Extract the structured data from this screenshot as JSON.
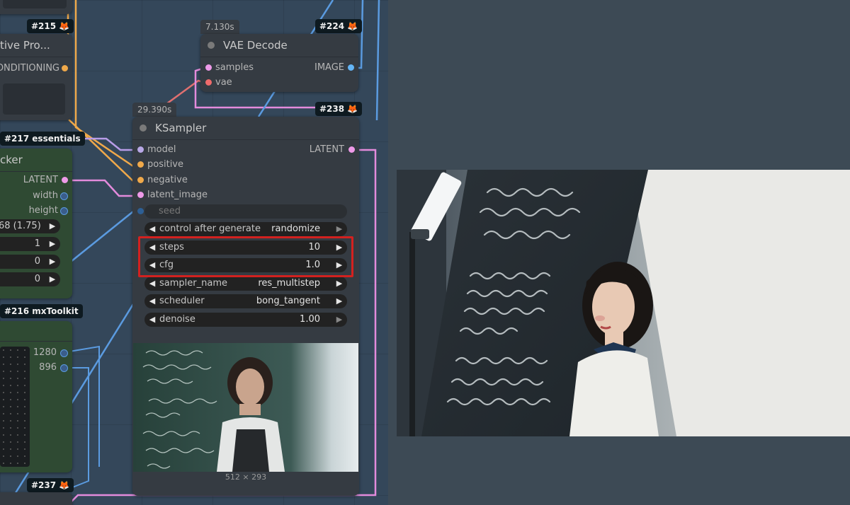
{
  "colors": {
    "canvas_bg": "#34475a",
    "node_bg": "#353b42",
    "green_node_bg": "#2f4a33",
    "highlight": "#d3211f",
    "wire_pink": "#e38bdc",
    "wire_orange": "#f0a94a",
    "wire_blue": "#5b9be0",
    "wire_lavender": "#b89de8",
    "wire_red": "#e07070",
    "latent_dot": "#ee9ae8",
    "model_dot": "#b8a8e6",
    "cond_dot": "#f0a94a",
    "vae_dot": "#ef6b6b",
    "image_dot": "#64b5f6",
    "int_dot": "#5b9be0"
  },
  "left_nodes": {
    "prompt_title": "tive Pro...",
    "prompt_output": "ONDITIONING",
    "badge_215": "#215",
    "badge_217": "#217 essentials",
    "latent_title": "cker",
    "latent_outputs": [
      "LATENT",
      "width",
      "height"
    ],
    "latent_values": [
      "68 (1.75)",
      "1",
      "0",
      "0"
    ],
    "badge_216": "#216 mxToolkit",
    "toolkit_values": [
      "1280",
      "896"
    ],
    "badge_237": "#237"
  },
  "vae_decode": {
    "timing": "7.130s",
    "badge": "#224",
    "title": "VAE Decode",
    "inputs": [
      "samples",
      "vae"
    ],
    "output": "IMAGE"
  },
  "ksampler": {
    "timing": "29.390s",
    "badge": "#238",
    "title": "KSampler",
    "inputs": [
      "model",
      "positive",
      "negative",
      "latent_image"
    ],
    "output": "LATENT",
    "seed_label": "seed",
    "widgets": [
      {
        "label": "control after generate",
        "value": "randomize"
      },
      {
        "label": "steps",
        "value": "10"
      },
      {
        "label": "cfg",
        "value": "1.0"
      },
      {
        "label": "sampler_name",
        "value": "res_multistep"
      },
      {
        "label": "scheduler",
        "value": "bong_tangent"
      },
      {
        "label": "denoise",
        "value": "1.00"
      }
    ],
    "preview_size": "512 × 293"
  },
  "icons": {
    "fox": "🦊",
    "arrow_left": "◀",
    "arrow_right": "▶"
  }
}
